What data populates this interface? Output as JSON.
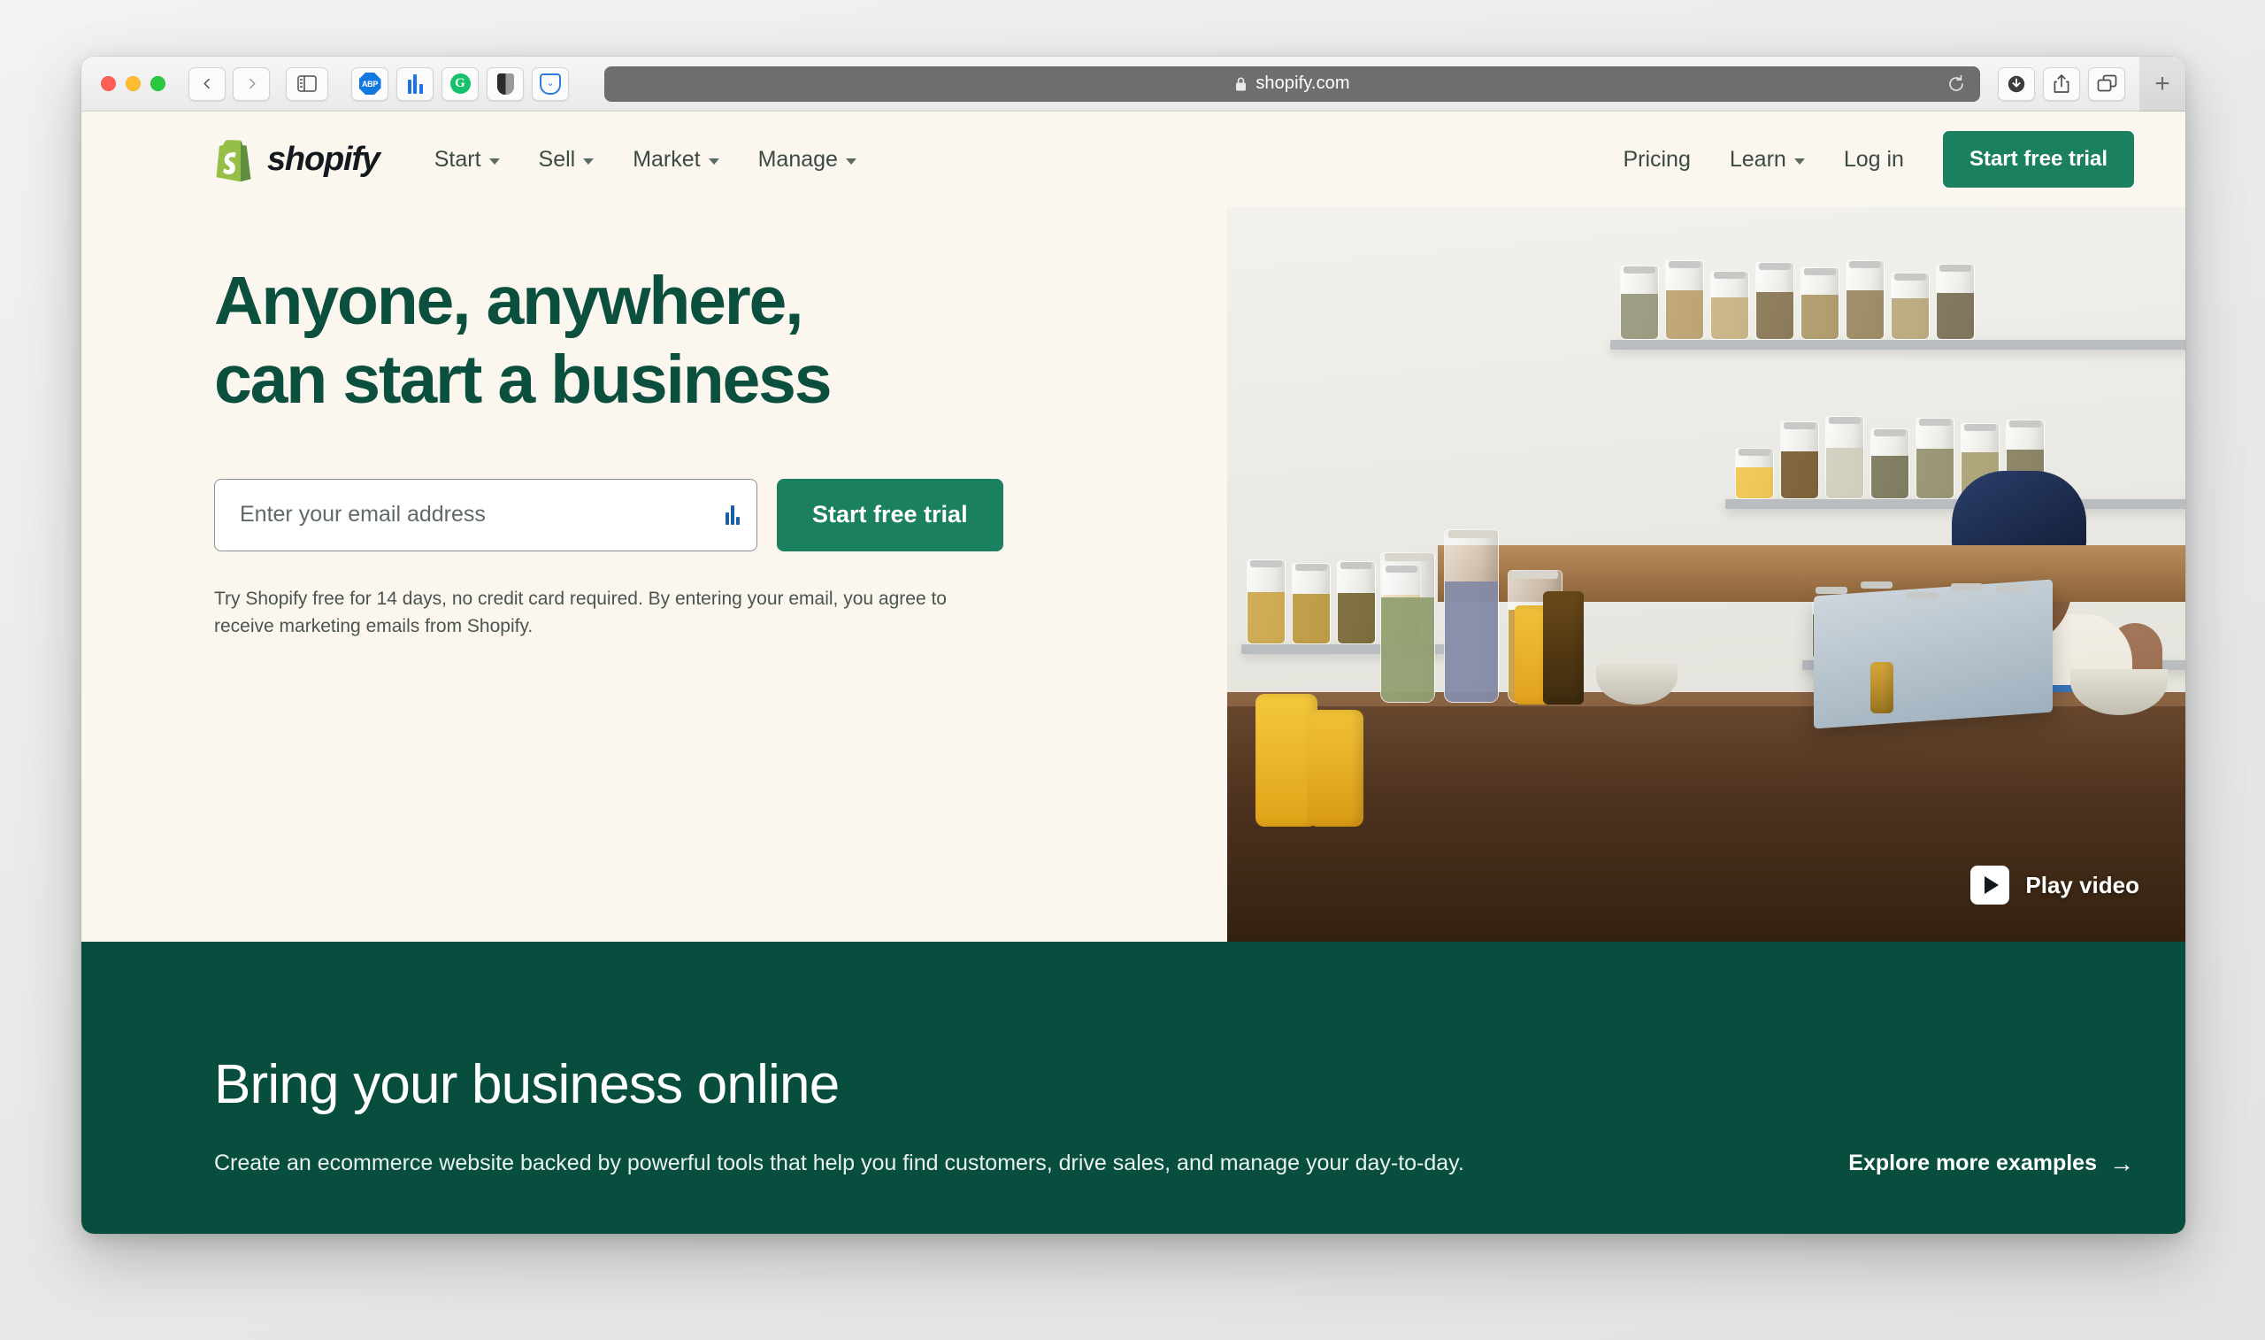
{
  "browser": {
    "url": "shopify.com",
    "lock_icon": "lock-icon",
    "reload_icon": "reload-icon",
    "traffic_lights": [
      "close",
      "minimize",
      "zoom"
    ],
    "back_icon": "chevron-left-icon",
    "forward_icon": "chevron-right-icon",
    "sidebar_icon": "sidebar-icon",
    "extensions": [
      {
        "name": "adblock-plus-icon",
        "label": "ABP"
      },
      {
        "name": "audio-bars-icon",
        "label": ""
      },
      {
        "name": "grammarly-icon",
        "label": "G"
      },
      {
        "name": "dark-reader-icon",
        "label": ""
      },
      {
        "name": "pocket-icon",
        "label": ""
      }
    ],
    "right_tools": [
      {
        "name": "downloads-icon"
      },
      {
        "name": "share-icon"
      },
      {
        "name": "tab-overview-icon"
      }
    ],
    "new_tab_label": "+"
  },
  "site": {
    "logo_text": "shopify",
    "nav_left": [
      {
        "label": "Start",
        "has_caret": true
      },
      {
        "label": "Sell",
        "has_caret": true
      },
      {
        "label": "Market",
        "has_caret": true
      },
      {
        "label": "Manage",
        "has_caret": true
      }
    ],
    "nav_right": [
      {
        "label": "Pricing",
        "has_caret": false
      },
      {
        "label": "Learn",
        "has_caret": true
      },
      {
        "label": "Log in",
        "has_caret": false
      }
    ],
    "header_cta": "Start free trial"
  },
  "hero": {
    "title_line1": "Anyone, anywhere,",
    "title_line2": "can start a business",
    "email_placeholder": "Enter your email address",
    "email_value": "",
    "autofill_icon": "autofill-icon",
    "submit_label": "Start free trial",
    "disclaimer": "Try Shopify free for 14 days, no credit card required. By entering your email, you agree to receive marketing emails from Shopify.",
    "play_video_label": "Play video",
    "play_icon": "play-icon"
  },
  "band": {
    "title": "Bring your business online",
    "subtitle": "Create an ecommerce website backed by powerful tools that help you find customers, drive sales, and manage your day-to-day.",
    "link_label": "Explore more examples",
    "link_arrow": "→"
  },
  "colors": {
    "cream": "#FBF7EE",
    "deep_green": "#084E3F",
    "brand_green": "#1A8060",
    "logo_green": "#95BF47",
    "heading_green": "#0B4F3F"
  }
}
